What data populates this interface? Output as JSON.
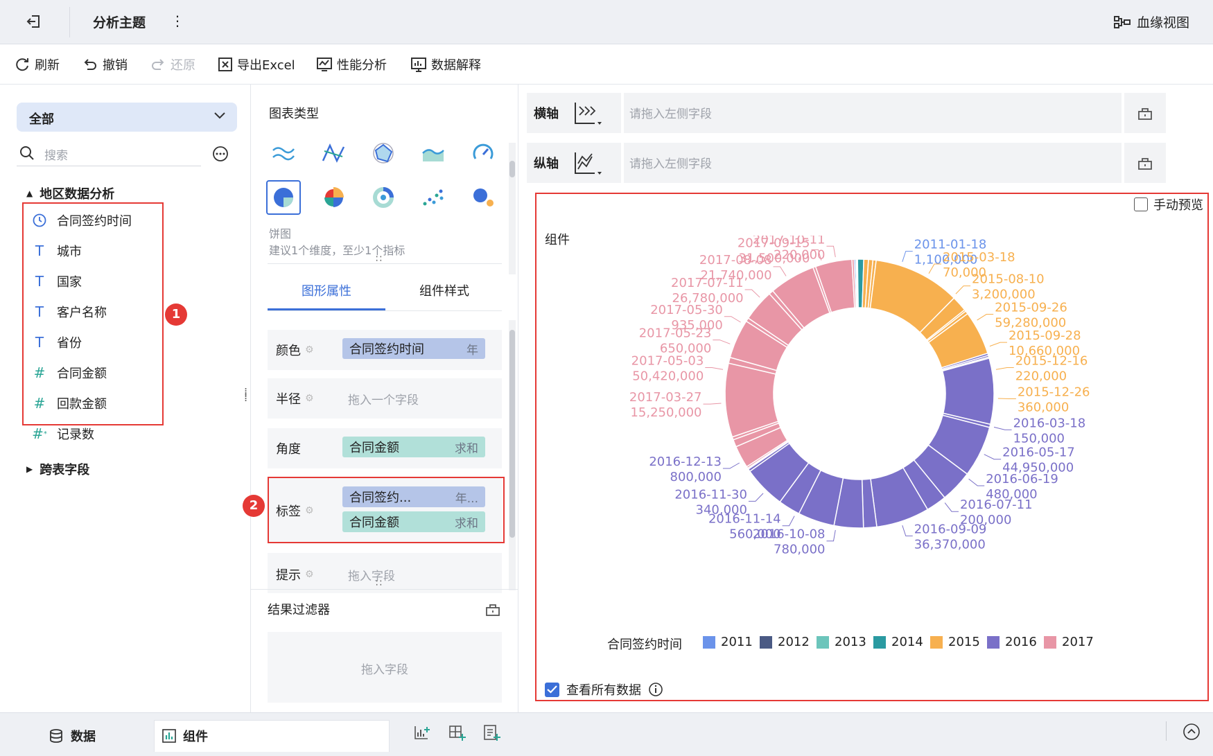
{
  "topbar": {
    "back_icon": "exit-icon",
    "title": "分析主题",
    "more_icon": "more-vertical-icon",
    "lineage_label": "血缘视图"
  },
  "toolbar": {
    "refresh": "刷新",
    "undo": "撤销",
    "redo": "还原",
    "export": "导出Excel",
    "performance": "性能分析",
    "explain": "数据解释"
  },
  "left": {
    "dropdown": "全部",
    "search_placeholder": "搜索",
    "group1": "地区数据分析",
    "fields": [
      {
        "icon": "clock-icon",
        "label": "合同签约时间"
      },
      {
        "icon": "text-type-icon",
        "label": "城市"
      },
      {
        "icon": "text-type-icon",
        "label": "国家"
      },
      {
        "icon": "text-type-icon",
        "label": "客户名称"
      },
      {
        "icon": "text-type-icon",
        "label": "省份"
      },
      {
        "icon": "number-type-icon",
        "label": "合同金额"
      },
      {
        "icon": "number-type-icon",
        "label": "回款金额"
      },
      {
        "icon": "count-type-icon",
        "label": "记录数"
      }
    ],
    "group2": "跨表字段",
    "badge1": "1"
  },
  "middle": {
    "chart_type_title": "图表类型",
    "chart_name": "饼图",
    "chart_hint": "建议1个维度，至少1个指标",
    "tab_props": "图形属性",
    "tab_style": "组件样式",
    "props": {
      "color": {
        "label": "颜色",
        "field": "合同签约时间",
        "sub": "年"
      },
      "radius": {
        "label": "半径",
        "placeholder": "拖入一个字段"
      },
      "angle": {
        "label": "角度",
        "field": "合同金额",
        "sub": "求和"
      },
      "tag": {
        "label": "标签",
        "field1": "合同签约...",
        "sub1": "年...",
        "field2": "合同金额",
        "sub2": "求和"
      },
      "tip": {
        "label": "提示",
        "placeholder": "拖入字段"
      }
    },
    "badge2": "2",
    "filter_title": "结果过滤器",
    "filter_placeholder": "拖入字段"
  },
  "axes": {
    "x_label": "横轴",
    "x_placeholder": "请拖入左侧字段",
    "y_label": "纵轴",
    "y_placeholder": "请拖入左侧字段"
  },
  "canvas": {
    "manual_preview": "手动预览",
    "widget_title": "组件",
    "view_all": "查看所有数据",
    "legend_title": "合同签约时间"
  },
  "colors": {
    "2011": "#6b93ea",
    "2012": "#4a5a84",
    "2013": "#6cc5bb",
    "2014": "#2a9aa1",
    "2015": "#f7b04f",
    "2016": "#7a70c8",
    "2017": "#e896a6"
  },
  "bottom": {
    "data_tab": "数据",
    "widget_tab": "组件"
  },
  "chart_data": {
    "type": "pie",
    "donut": true,
    "legend_title": "合同签约时间",
    "legend": [
      "2011",
      "2012",
      "2013",
      "2014",
      "2015",
      "2016",
      "2017"
    ],
    "slices": [
      {
        "year": "2011",
        "value": 1100000
      },
      {
        "year": "2012",
        "value": 500000
      },
      {
        "year": "2013",
        "value": 700000
      },
      {
        "year": "2014",
        "value": 4200000
      },
      {
        "year": "2015",
        "value": 3200000
      },
      {
        "year": "2015",
        "value": 3000000
      },
      {
        "year": "2015",
        "value": 2200000
      },
      {
        "year": "2015",
        "value": 59280000
      },
      {
        "year": "2015",
        "value": 10660000
      },
      {
        "year": "2015",
        "value": 1200000
      },
      {
        "year": "2015",
        "value": 2100000
      },
      {
        "year": "2015",
        "value": 30000000
      },
      {
        "year": "2016",
        "value": 1500000
      },
      {
        "year": "2016",
        "value": 1200000
      },
      {
        "year": "2016",
        "value": 800000
      },
      {
        "year": "2016",
        "value": 44950000
      },
      {
        "year": "2016",
        "value": 2200000
      },
      {
        "year": "2016",
        "value": 35000000
      },
      {
        "year": "2016",
        "value": 22000000
      },
      {
        "year": "2016",
        "value": 14000000
      },
      {
        "year": "2016",
        "value": 36370000
      },
      {
        "year": "2016",
        "value": 9000000
      },
      {
        "year": "2016",
        "value": 20000000
      },
      {
        "year": "2016",
        "value": 25000000
      },
      {
        "year": "2016",
        "value": 15000000
      },
      {
        "year": "2016",
        "value": 29000000
      },
      {
        "year": "2016",
        "value": 1800000
      },
      {
        "year": "2016",
        "value": 800000
      },
      {
        "year": "2017",
        "value": 1200000
      },
      {
        "year": "2017",
        "value": 15250000
      },
      {
        "year": "2017",
        "value": 5000000
      },
      {
        "year": "2017",
        "value": 2000000
      },
      {
        "year": "2017",
        "value": 50420000
      },
      {
        "year": "2017",
        "value": 4000000
      },
      {
        "year": "2017",
        "value": 26780000
      },
      {
        "year": "2017",
        "value": 2500000
      },
      {
        "year": "2017",
        "value": 21740000
      },
      {
        "year": "2017",
        "value": 3000000
      },
      {
        "year": "2017",
        "value": 31500000
      },
      {
        "year": "2017",
        "value": 1800000
      },
      {
        "year": "2017",
        "value": 25000000
      },
      {
        "year": "2017",
        "value": 1500000
      }
    ],
    "labels": [
      {
        "date": "2017-10-11",
        "value": "220,000",
        "year": "2017"
      },
      {
        "date": "2011-01-18",
        "value": "1,100,000",
        "year": "2011"
      },
      {
        "date": "2015-03-18",
        "value": "70,000",
        "year": "2015"
      },
      {
        "date": "2015-08-10",
        "value": "3,200,000",
        "year": "2015"
      },
      {
        "date": "2015-09-26",
        "value": "59,280,000",
        "year": "2015"
      },
      {
        "date": "2015-09-28",
        "value": "10,660,000",
        "year": "2015"
      },
      {
        "date": "2015-12-16",
        "value": "220,000",
        "year": "2015"
      },
      {
        "date": "2015-12-26",
        "value": "360,000",
        "year": "2015"
      },
      {
        "date": "2016-03-18",
        "value": "150,000",
        "year": "2016"
      },
      {
        "date": "2016-05-17",
        "value": "44,950,000",
        "year": "2016"
      },
      {
        "date": "2016-06-19",
        "value": "480,000",
        "year": "2016"
      },
      {
        "date": "2016-07-11",
        "value": "200,000",
        "year": "2016"
      },
      {
        "date": "2016-09-09",
        "value": "36,370,000",
        "year": "2016"
      },
      {
        "date": "2016-10-08",
        "value": "780,000",
        "year": "2016"
      },
      {
        "date": "2016-11-14",
        "value": "560,000",
        "year": "2016"
      },
      {
        "date": "2016-11-30",
        "value": "340,000",
        "year": "2016"
      },
      {
        "date": "2016-12-13",
        "value": "800,000",
        "year": "2016"
      },
      {
        "date": "2017-03-27",
        "value": "15,250,000",
        "year": "2017"
      },
      {
        "date": "2017-05-03",
        "value": "50,420,000",
        "year": "2017"
      },
      {
        "date": "2017-05-23",
        "value": "650,000",
        "year": "2017"
      },
      {
        "date": "2017-05-30",
        "value": "935,000",
        "year": "2017"
      },
      {
        "date": "2017-07-11",
        "value": "26,780,000",
        "year": "2017"
      },
      {
        "date": "2017-08-08",
        "value": "21,740,000",
        "year": "2017"
      },
      {
        "date": "2017-09-15",
        "value": "31,500,000",
        "year": "2017"
      }
    ]
  }
}
